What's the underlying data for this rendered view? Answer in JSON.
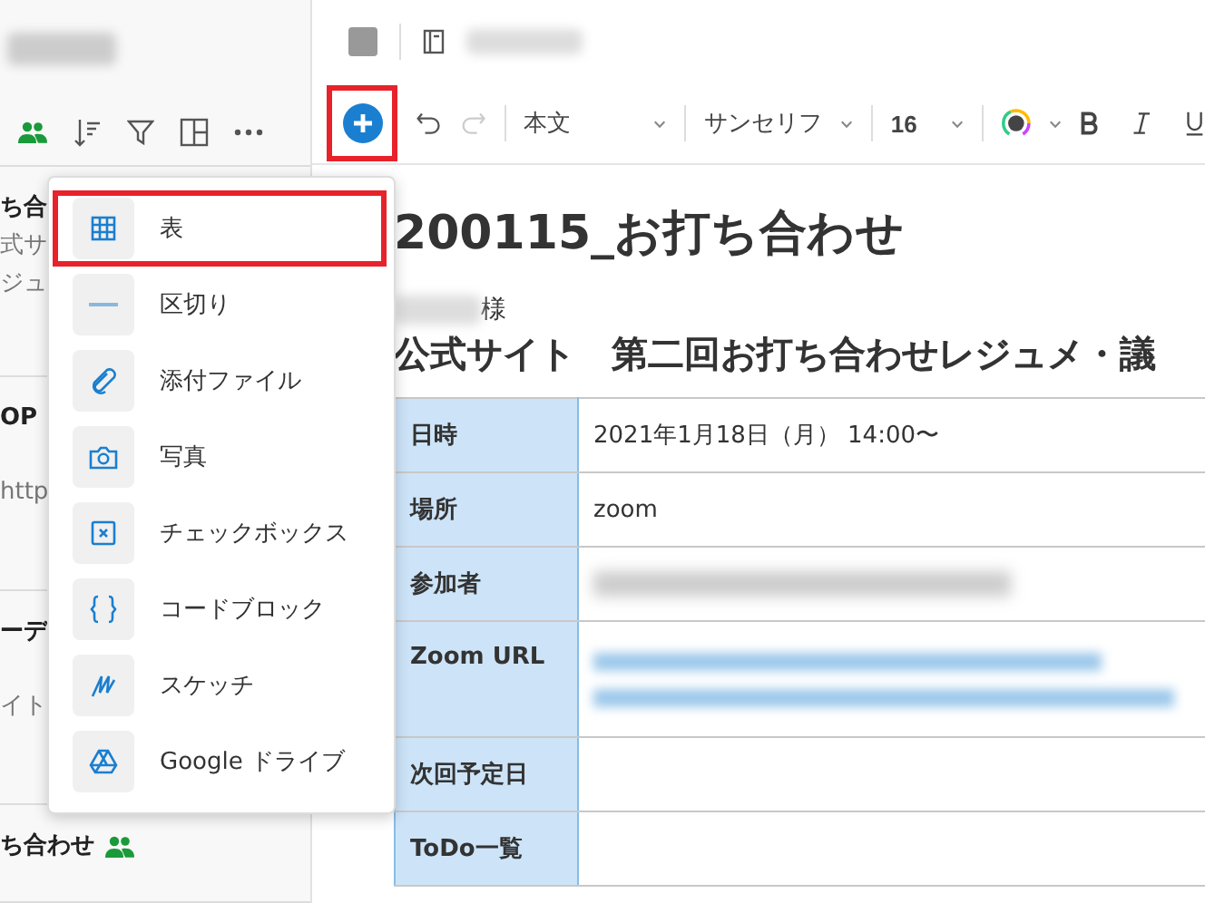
{
  "sidebar": {
    "notes": [
      {
        "lines": [
          "ち合",
          "式サ",
          "ジュ"
        ]
      },
      {
        "lines": [
          "OP",
          "http"
        ]
      },
      {
        "lines": [
          "ーデ",
          "イト"
        ]
      },
      {
        "lines": [
          "ち合わせ"
        ],
        "shared": true
      }
    ]
  },
  "toolbar": {
    "insert_highlighted": true,
    "paragraph_style": "本文",
    "font": "サンセリフ",
    "size": "16"
  },
  "insert_menu": {
    "items": [
      {
        "kind": "table",
        "label": "表",
        "selected": true
      },
      {
        "kind": "divider",
        "label": "区切り",
        "selected": false
      },
      {
        "kind": "attachment",
        "label": "添付ファイル",
        "selected": false
      },
      {
        "kind": "photo",
        "label": "写真",
        "selected": false
      },
      {
        "kind": "checkbox",
        "label": "チェックボックス",
        "selected": false
      },
      {
        "kind": "code",
        "label": "コードブロック",
        "selected": false
      },
      {
        "kind": "sketch",
        "label": "スケッチ",
        "selected": false
      },
      {
        "kind": "drive",
        "label": "Google ドライブ",
        "selected": false
      }
    ]
  },
  "document": {
    "title": "200115_お打ち合わせ",
    "recipient_suffix": "様",
    "heading": "公式サイト　第二回お打ち合わせレジュメ・議",
    "table": {
      "rows": [
        {
          "label": "日時",
          "kind": "text",
          "value": "2021年1月18日（月） 14:00〜"
        },
        {
          "label": "場所",
          "kind": "text",
          "value": "zoom"
        },
        {
          "label": "参加者",
          "kind": "redacted"
        },
        {
          "label": "Zoom URL",
          "kind": "redacted_link"
        },
        {
          "label": "次回予定日",
          "kind": "empty"
        },
        {
          "label": "ToDo一覧",
          "kind": "empty"
        }
      ]
    }
  }
}
